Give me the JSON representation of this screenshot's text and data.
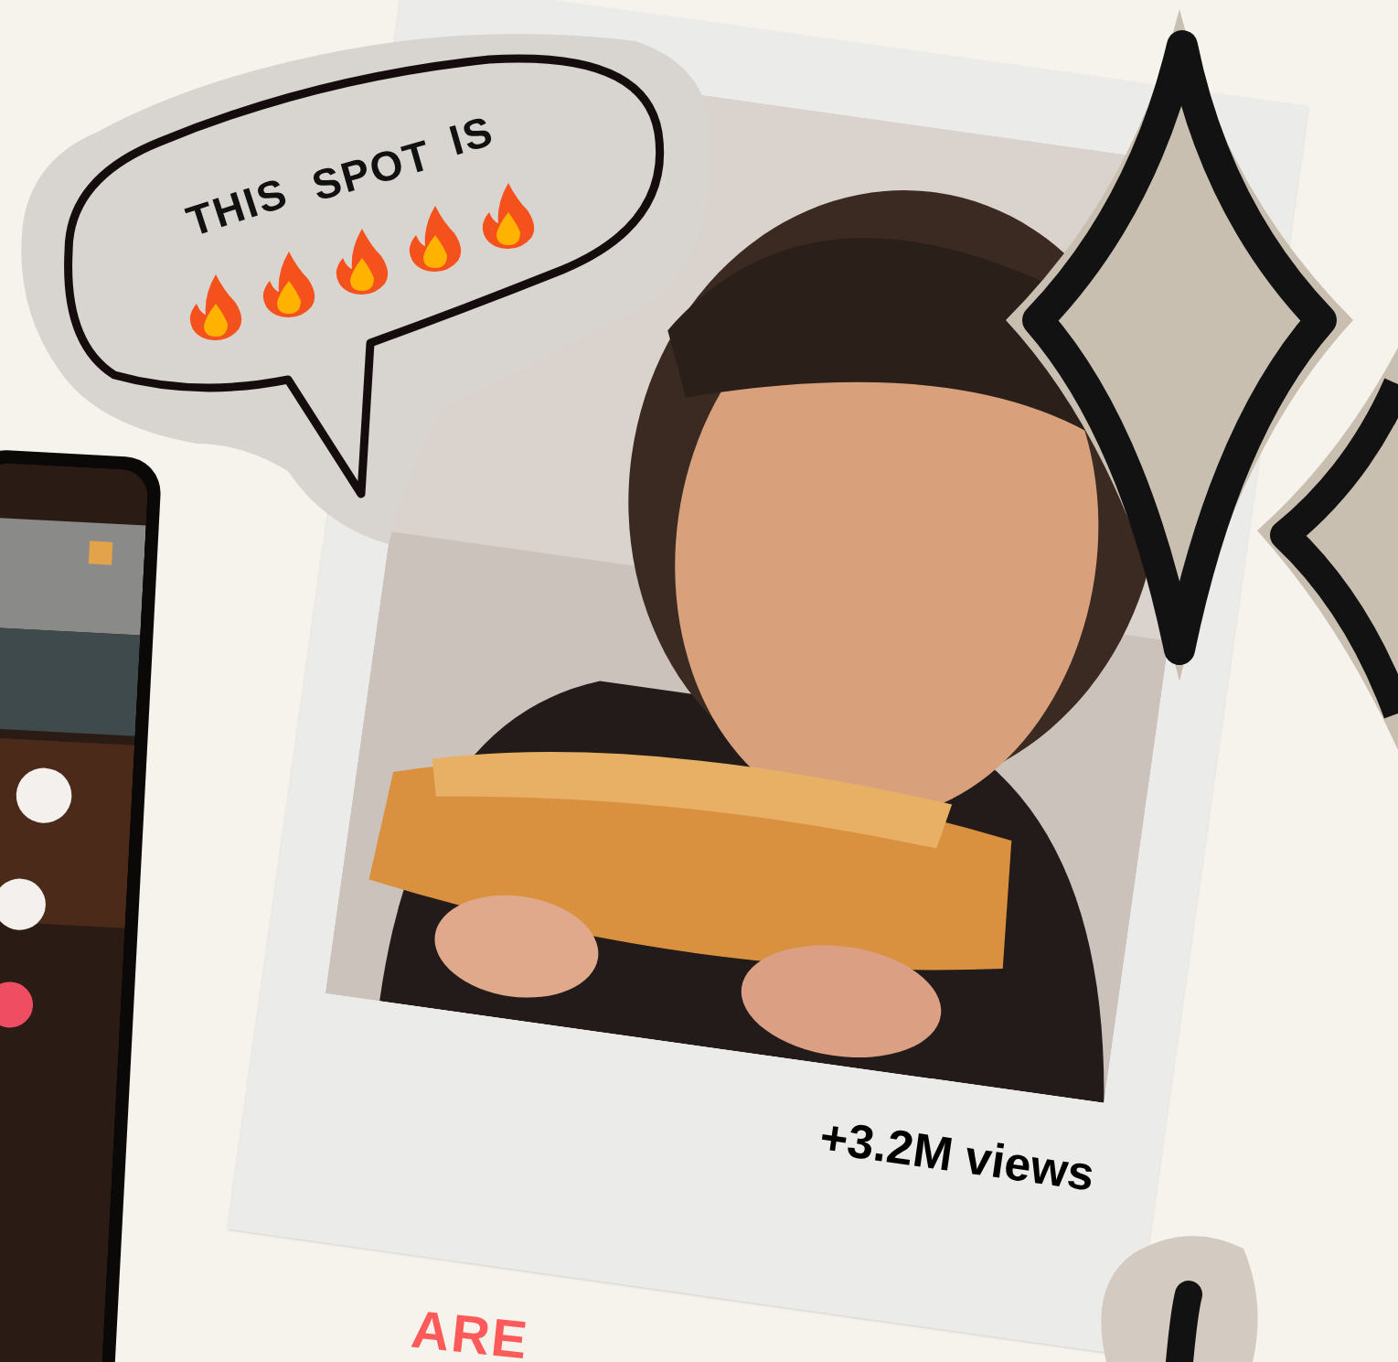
{
  "speech_sticker": {
    "words": [
      "THIS",
      "SPOT",
      "IS"
    ]
  },
  "polaroid": {
    "caption": "+3.2M views"
  },
  "heading": "ARE"
}
